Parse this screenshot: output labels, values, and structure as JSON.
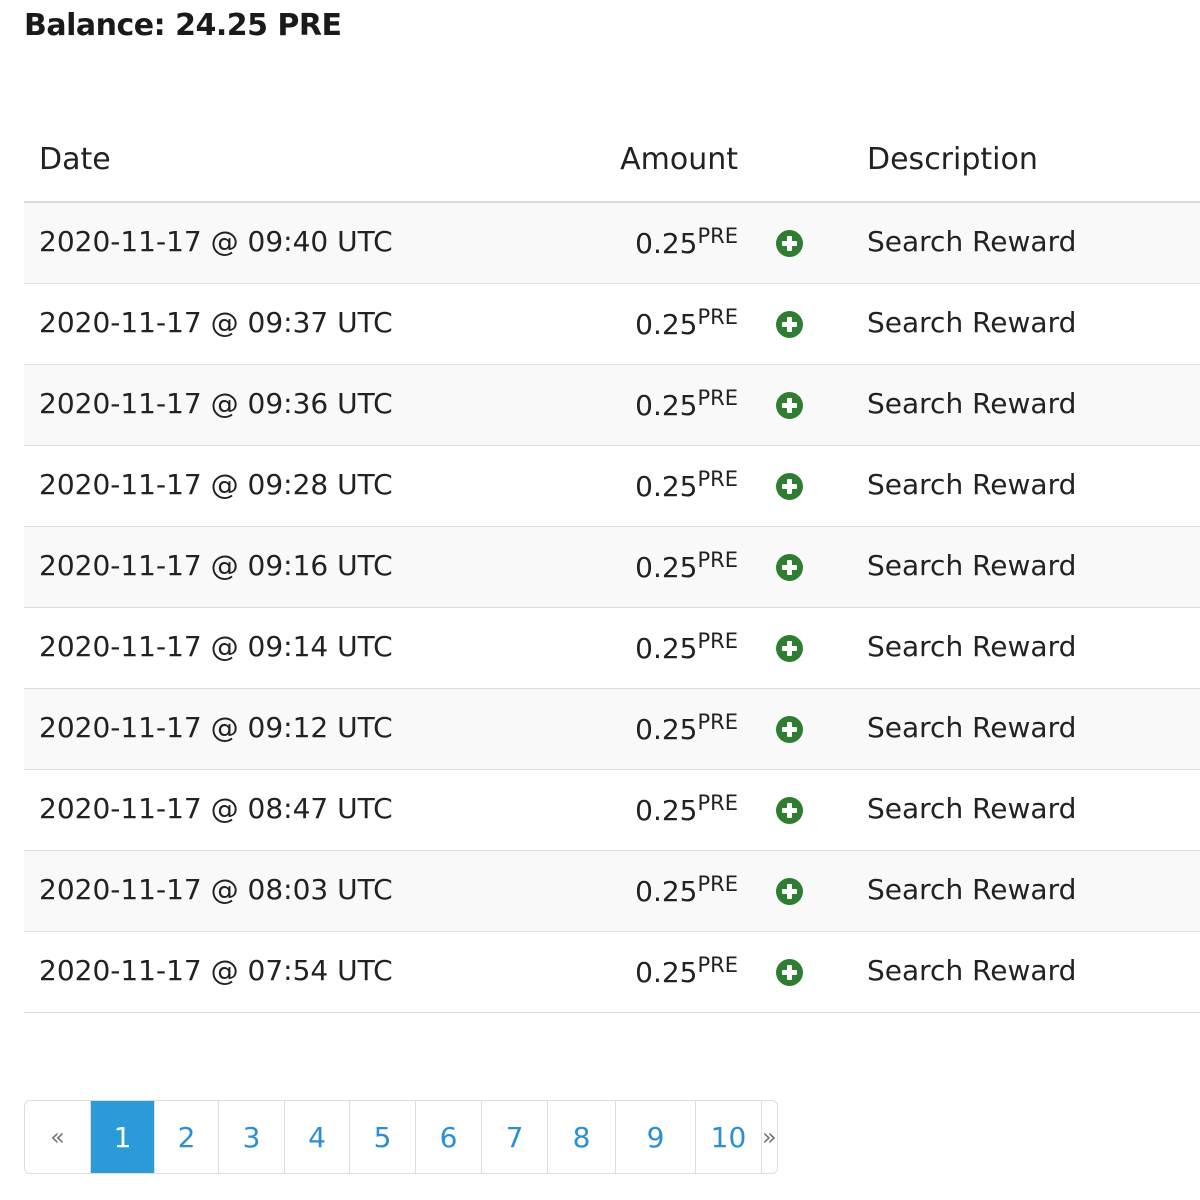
{
  "balance": {
    "label": "Balance: 24.25 PRE"
  },
  "table": {
    "headers": {
      "date": "Date",
      "amount": "Amount",
      "description": "Description"
    },
    "rows": [
      {
        "date": "2020-11-17 @ 09:40 UTC",
        "amount": "0.25",
        "unit": "PRE",
        "icon": "plus-circle-icon",
        "description": "Search Reward"
      },
      {
        "date": "2020-11-17 @ 09:37 UTC",
        "amount": "0.25",
        "unit": "PRE",
        "icon": "plus-circle-icon",
        "description": "Search Reward"
      },
      {
        "date": "2020-11-17 @ 09:36 UTC",
        "amount": "0.25",
        "unit": "PRE",
        "icon": "plus-circle-icon",
        "description": "Search Reward"
      },
      {
        "date": "2020-11-17 @ 09:28 UTC",
        "amount": "0.25",
        "unit": "PRE",
        "icon": "plus-circle-icon",
        "description": "Search Reward"
      },
      {
        "date": "2020-11-17 @ 09:16 UTC",
        "amount": "0.25",
        "unit": "PRE",
        "icon": "plus-circle-icon",
        "description": "Search Reward"
      },
      {
        "date": "2020-11-17 @ 09:14 UTC",
        "amount": "0.25",
        "unit": "PRE",
        "icon": "plus-circle-icon",
        "description": "Search Reward"
      },
      {
        "date": "2020-11-17 @ 09:12 UTC",
        "amount": "0.25",
        "unit": "PRE",
        "icon": "plus-circle-icon",
        "description": "Search Reward"
      },
      {
        "date": "2020-11-17 @ 08:47 UTC",
        "amount": "0.25",
        "unit": "PRE",
        "icon": "plus-circle-icon",
        "description": "Search Reward"
      },
      {
        "date": "2020-11-17 @ 08:03 UTC",
        "amount": "0.25",
        "unit": "PRE",
        "icon": "plus-circle-icon",
        "description": "Search Reward"
      },
      {
        "date": "2020-11-17 @ 07:54 UTC",
        "amount": "0.25",
        "unit": "PRE",
        "icon": "plus-circle-icon",
        "description": "Search Reward"
      }
    ]
  },
  "pagination": {
    "prev": "«",
    "next": "»",
    "pages": [
      "1",
      "2",
      "3",
      "4",
      "5",
      "6",
      "7",
      "8",
      "9",
      "10"
    ],
    "current_page": "1"
  },
  "colors": {
    "positive_icon": "#2e7d32",
    "link": "#2a8fd4",
    "active_page_bg": "#2a9ad9",
    "striped_row": "#f9f9f9"
  }
}
